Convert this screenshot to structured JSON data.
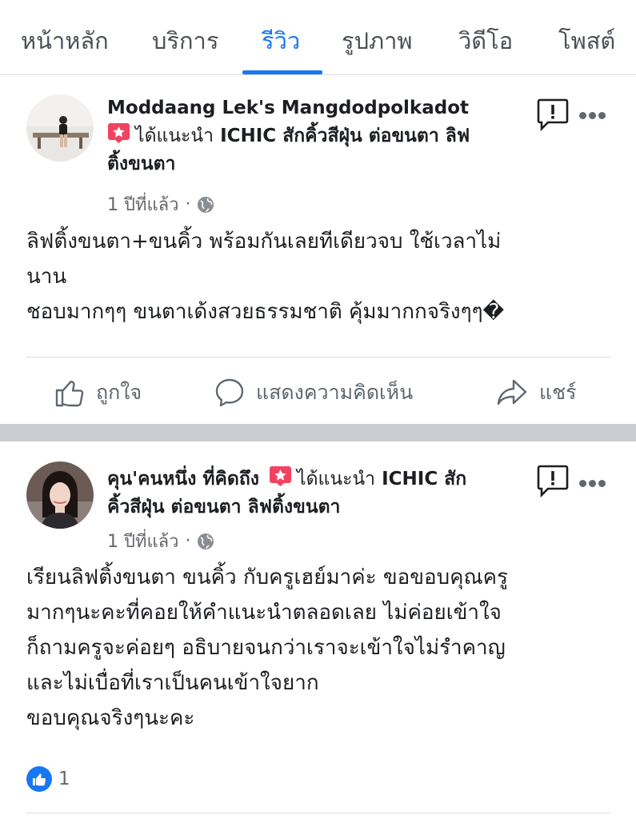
{
  "tabs": [
    {
      "label": "หน้าหลัก"
    },
    {
      "label": "บริการ"
    },
    {
      "label": "รีวิว"
    },
    {
      "label": "รูปภาพ"
    },
    {
      "label": "วิดีโอ"
    },
    {
      "label": "โพสต์"
    }
  ],
  "active_tab": "รีวิว",
  "posts": [
    {
      "author": "Moddaang Lek's Mangdodpolkadot",
      "recommend_text": "ได้แนะนำ",
      "business_line1": "ICHIC สักคิ้วสีฝุ่น ต่อขนตา ลิฟ",
      "business_line2": "ติ้งขนตา",
      "time": "1 ปีที่แล้ว",
      "body": [
        "ลิฟติ้งขนตา+ขนคิ้ว พร้อมกันเลยทีเดียวจบ ใช้เวลาไม่",
        "นาน",
        "ชอบมากๆๆ ขนตาเด้งสวยธรรมชาติ คุ้มมากกจริงๆๆ�"
      ],
      "actions": {
        "like": "ถูกใจ",
        "comment": "แสดงความคิดเห็น",
        "share": "แชร์"
      }
    },
    {
      "author": "คุน'คนหนึ่ง ที่คิดถึง",
      "recommend_text": "ได้แนะนำ",
      "business_line1": "ICHIC สัก",
      "business_line2": "คิ้วสีฝุ่น ต่อขนตา ลิฟติ้งขนตา",
      "time": "1 ปีที่แล้ว",
      "body": [
        "เรียนลิฟติ้งขนตา ขนคิ้ว กับครูเฮย์มาค่ะ ขอขอบคุณครู",
        "มากๆนะคะที่คอยให้คำแนะนำตลอดเลย ไม่ค่อยเข้าใจ",
        "ก็ถามครูจะค่อยๆ อธิบายจนกว่าเราจะเข้าใจไม่รำคาญ",
        "และไม่เบื่อที่เราเป็นคนเข้าใจยาก",
        "ขอบคุณจริงๆนะคะ"
      ],
      "reaction_count": "1"
    }
  ],
  "colors": {
    "accent": "#1877f2",
    "recommend": "#f3425f",
    "muted": "#65676b"
  }
}
